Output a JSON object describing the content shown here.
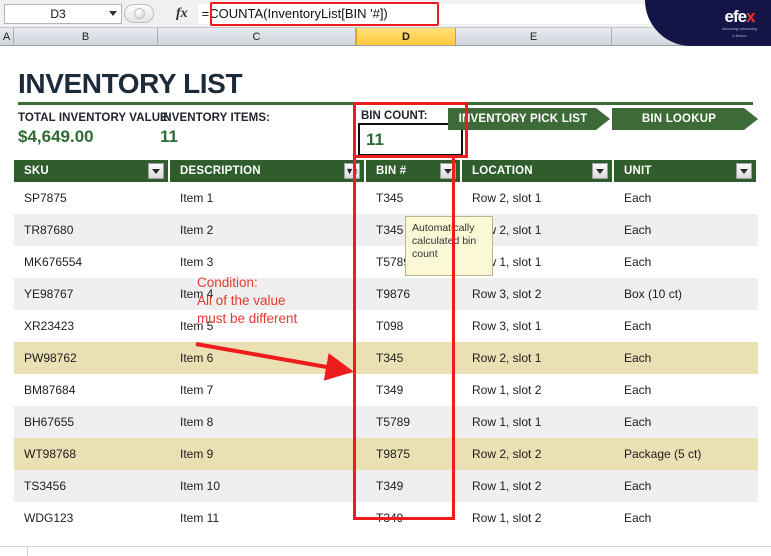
{
  "formula_bar": {
    "name_box_value": "D3",
    "fx_label": "fx",
    "formula": "=COUNTA(InventoryList[BIN '#])"
  },
  "column_headers": [
    "A",
    "B",
    "C",
    "D",
    "E"
  ],
  "active_column": "D",
  "header": {
    "title": "INVENTORY LIST",
    "total_value_label": "TOTAL INVENTORY VALUE:",
    "total_value": "$4,649.00",
    "items_label": "INVENTORY ITEMS:",
    "items_value": "11",
    "bin_count_label": "BIN COUNT:",
    "bin_count_value": "11"
  },
  "buttons": {
    "pick_list": "INVENTORY PICK LIST",
    "bin_lookup": "BIN LOOKUP"
  },
  "table": {
    "columns": [
      "SKU",
      "DESCRIPTION",
      "BIN #",
      "LOCATION",
      "UNIT"
    ],
    "rows": [
      {
        "sku": "SP7875",
        "description": "Item 1",
        "bin": "T345",
        "location": "Row 2, slot 1",
        "unit": "Each",
        "highlight": "none"
      },
      {
        "sku": "TR87680",
        "description": "Item 2",
        "bin": "T345",
        "location": "Row 2, slot 1",
        "unit": "Each",
        "highlight": "alt"
      },
      {
        "sku": "MK676554",
        "description": "Item 3",
        "bin": "T5789",
        "location": "Row 1, slot 1",
        "unit": "Each",
        "highlight": "none"
      },
      {
        "sku": "YE98767",
        "description": "Item 4",
        "bin": "T9876",
        "location": "Row 3, slot 2",
        "unit": "Box (10 ct)",
        "highlight": "alt"
      },
      {
        "sku": "XR23423",
        "description": "Item 5",
        "bin": "T098",
        "location": "Row 3, slot 1",
        "unit": "Each",
        "highlight": "none"
      },
      {
        "sku": "PW98762",
        "description": "Item 6",
        "bin": "T345",
        "location": "Row 2, slot 1",
        "unit": "Each",
        "highlight": "hl"
      },
      {
        "sku": "BM87684",
        "description": "Item 7",
        "bin": "T349",
        "location": "Row 1, slot 2",
        "unit": "Each",
        "highlight": "none"
      },
      {
        "sku": "BH67655",
        "description": "Item 8",
        "bin": "T5789",
        "location": "Row 1, slot 1",
        "unit": "Each",
        "highlight": "alt"
      },
      {
        "sku": "WT98768",
        "description": "Item 9",
        "bin": "T9875",
        "location": "Row 2, slot 2",
        "unit": "Package (5 ct)",
        "highlight": "hl"
      },
      {
        "sku": "TS3456",
        "description": "Item 10",
        "bin": "T349",
        "location": "Row 1, slot 2",
        "unit": "Each",
        "highlight": "alt"
      },
      {
        "sku": "WDG123",
        "description": "Item 11",
        "bin": "T349",
        "location": "Row 1, slot 2",
        "unit": "Each",
        "highlight": "none"
      }
    ]
  },
  "comment": {
    "text": "Automatically calculated bin count"
  },
  "annotation": {
    "line1": "Condition:",
    "line2": "All of the value",
    "line3": "must be different"
  },
  "logo": {
    "word_1": "efe",
    "word_2": "x",
    "sub_1": "accounting  outsourcing",
    "sub_2": "& finance"
  },
  "colors": {
    "accent_green": "#2f5d2c",
    "button_green": "#3d6b37",
    "value_green": "#2f6b35",
    "annotation_red": "#ee1c1c",
    "highlight_tan": "#ebdfb4",
    "logo_navy": "#141446"
  }
}
